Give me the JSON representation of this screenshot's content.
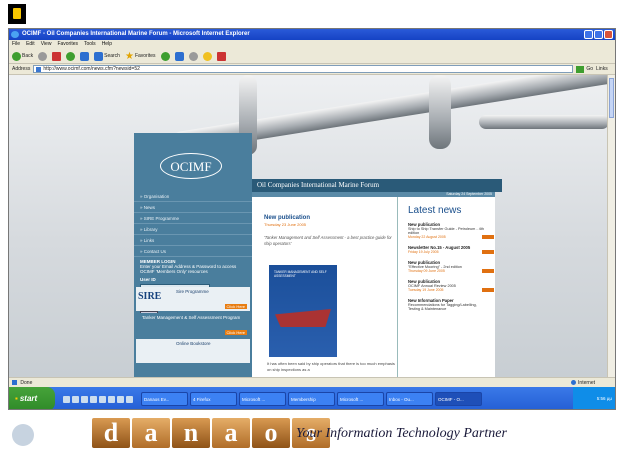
{
  "window": {
    "title": "OCIMF - Oil Companies International Marine Forum - Microsoft Internet Explorer",
    "menu": [
      "File",
      "Edit",
      "View",
      "Favorites",
      "Tools",
      "Help"
    ]
  },
  "toolbar": {
    "back_label": "Back",
    "search_label": "Search",
    "favorites_label": "Favorites"
  },
  "address": {
    "label": "Address",
    "url": "http://www.ocimf.com/news.cfm?newsid=52",
    "go_label": "Go",
    "links_label": "Links"
  },
  "site": {
    "logo": "OCIMF",
    "banner": "Oil Companies International Marine Forum",
    "date": "Saturday 24 September 2005",
    "nav": [
      "Organisation",
      "News",
      "SIRE Programme",
      "Library",
      "Links",
      "Contact Us"
    ],
    "login": {
      "heading": "MEMBER LOGIN",
      "intro": "Enter your Email Address & Password to access OCIMF 'Members Only' resources",
      "user_label": "User ID",
      "password_label": "Password",
      "button": "Enter"
    },
    "promos": [
      {
        "mark": "SIRE",
        "title": "Sire Programme",
        "cta": "Click Here"
      },
      {
        "mark": "",
        "title": "Tanker Management & Self Assessment Program",
        "cta": "Click Here"
      }
    ],
    "online_bookstore": "Online Bookstore"
  },
  "publication": {
    "title": "New publication",
    "date": "Thursday 23 June 2005",
    "description": "'Tanker Management and Self Assessment - a best practice guide for ship operators'",
    "cover_text": "TANKER MANAGEMENT AND SELF ASSESSMENT",
    "footer_text": "It has often been said by ship operators that there is too much emphasis on ship inspections as a"
  },
  "news": {
    "heading": "Latest news",
    "items": [
      {
        "title": "New publication",
        "desc": "Ship to Ship Transfer Guide - Petroleum - 4th edition",
        "date": "Monday 22 August 2005"
      },
      {
        "title": "Newsletter No.15 - August 2005",
        "desc": "",
        "date": "Friday 19 July 2005"
      },
      {
        "title": "New publication",
        "desc": "\"Effective Mooring\" - 2nd edition",
        "date": "Thursday 09 June 2005"
      },
      {
        "title": "New publication",
        "desc": "OCIMF Annual Review 2005",
        "date": "Tuesday 19 June 2005"
      },
      {
        "title": "New Information Paper",
        "desc": "Recommendations for Tagging/Labelling, Testing & Maintenance",
        "date": ""
      }
    ]
  },
  "status": {
    "left": "Done",
    "zone": "Internet"
  },
  "taskbar": {
    "start": "start",
    "tasks": [
      "Danaos Ev...",
      "4 Firefox",
      "Microsoft ...",
      "Membership",
      "Microsoft ...",
      "Inbox - Ou...",
      "OCIMF - O..."
    ],
    "clock": "5:56 μμ"
  },
  "footer": {
    "logo_letters": [
      "d",
      "a",
      "n",
      "a",
      "o",
      "s"
    ],
    "slogan": "Your Information Technology Partner"
  }
}
